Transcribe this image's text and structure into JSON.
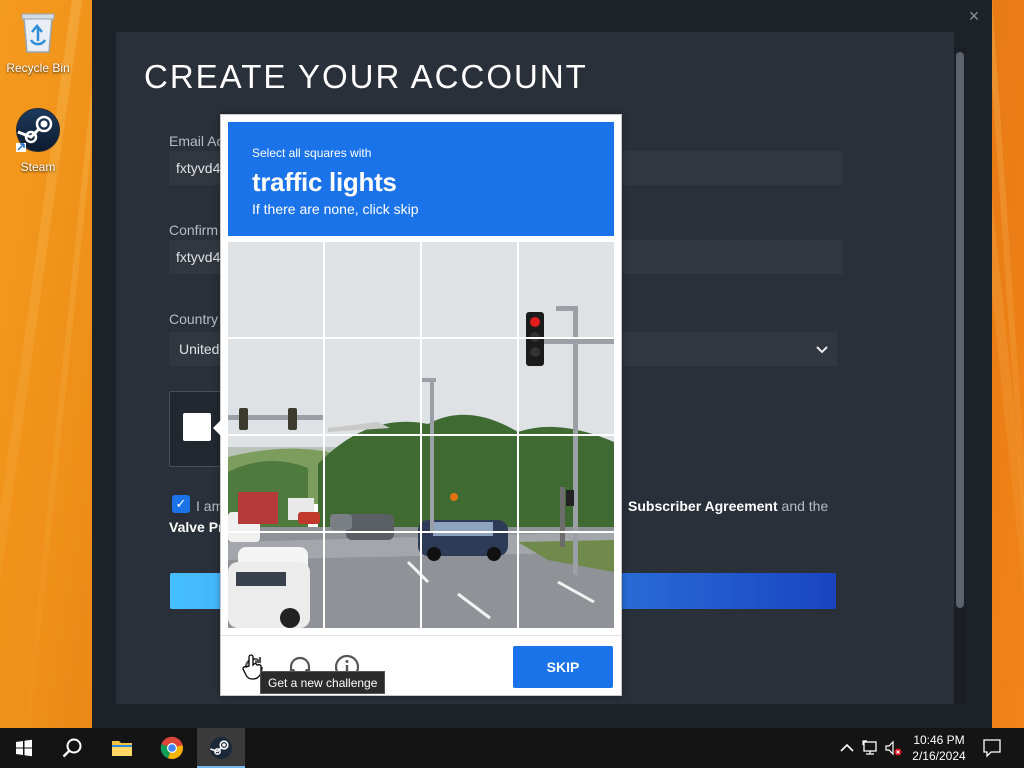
{
  "desktop": {
    "icons": [
      {
        "label": "Recycle Bin",
        "icon": "recycle-bin-icon"
      },
      {
        "label": "Steam",
        "icon": "steam-icon"
      }
    ]
  },
  "steam_window": {
    "close_glyph": "×",
    "title": "CREATE YOUR ACCOUNT",
    "email_label": "Email Ac",
    "email_value": "fxtyvd4",
    "confirm_label": "Confirm",
    "confirm_value": "fxtyvd4",
    "country_label": "Country",
    "country_value": "United",
    "agree_prefix": "I am",
    "agree_link": "Subscriber Agreement",
    "agree_suffix": "and the",
    "agree_line2": "Valve Pr",
    "agree_checked": true,
    "accent_color": "#1a73e8"
  },
  "challenge": {
    "prompt_small": "Select all squares with",
    "prompt_object": "traffic lights",
    "prompt_hint": "If there are none, click skip",
    "grid_size": "4x4",
    "footer_icons": [
      "refresh-icon",
      "audio-icon",
      "info-icon"
    ],
    "tooltip": "Get a new challenge",
    "skip_label": "SKIP"
  },
  "taskbar": {
    "buttons": [
      "windows-start-icon",
      "search-icon",
      "file-explorer-icon",
      "chrome-icon",
      "steam-icon"
    ],
    "tray_icons": [
      "chevron-up-icon",
      "network-icon",
      "volume-muted-icon",
      "notification-icon"
    ],
    "time": "10:46 PM",
    "date": "2/16/2024"
  }
}
